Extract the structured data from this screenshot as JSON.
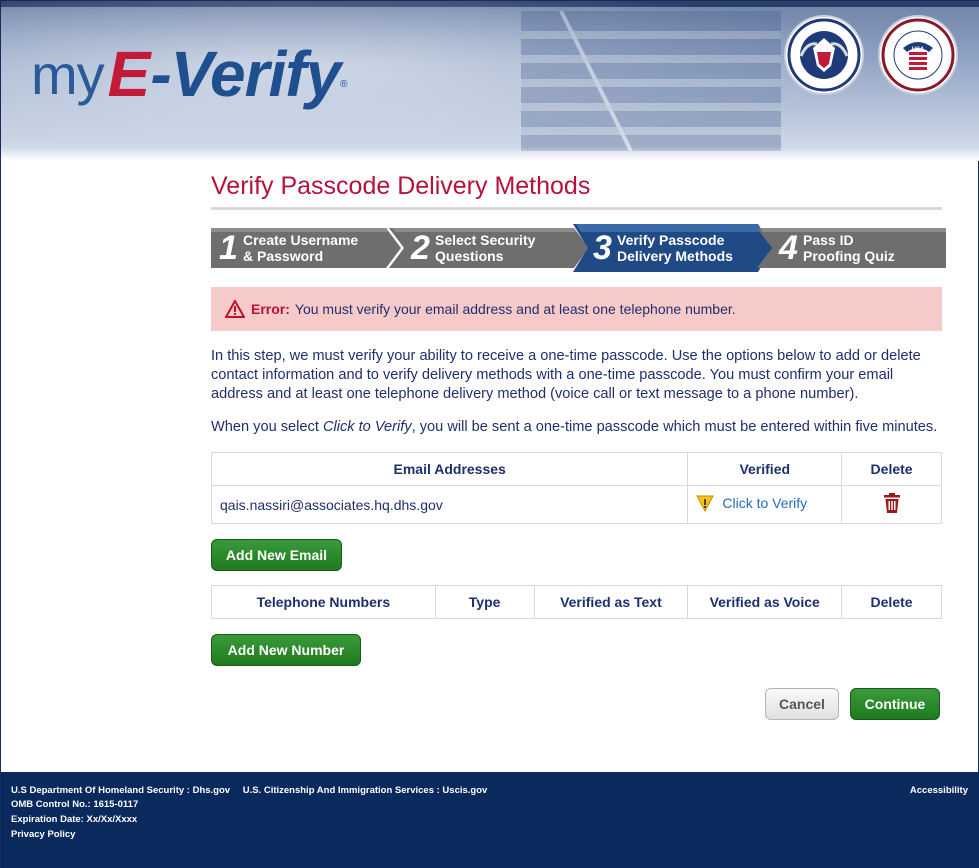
{
  "header": {
    "logo_my": "my",
    "logo_e": "E",
    "logo_verify": "-Verify",
    "logo_reg": "®",
    "seal_dhs_text": "U.S. DEPARTMENT OF HOMELAND SECURITY",
    "seal_ssa_text": "SOCIAL SECURITY ADMINISTRATION",
    "seal_ssa_usa": "USA"
  },
  "page": {
    "title": "Verify Passcode Delivery Methods"
  },
  "steps": [
    {
      "num": "1",
      "line1": "Create Username",
      "line2": "& Password",
      "active": false
    },
    {
      "num": "2",
      "line1": "Select Security",
      "line2": "Questions",
      "active": false
    },
    {
      "num": "3",
      "line1": "Verify Passcode",
      "line2": "Delivery Methods",
      "active": true
    },
    {
      "num": "4",
      "line1": "Pass ID",
      "line2": "Proofing Quiz",
      "active": false
    }
  ],
  "error": {
    "label": "Error:",
    "message": "You must verify your email address and at least one telephone number."
  },
  "intro": {
    "para1": "In this step, we must verify your ability to receive a one-time passcode. Use the options below to add or delete contact information and to verify delivery methods with a one-time passcode. You must confirm your email address and at least one telephone delivery method (voice call or text message to a phone number).",
    "para2_before": "When you select ",
    "para2_em": "Click to Verify",
    "para2_after": ", you will be sent a one-time passcode which must be entered within five minutes."
  },
  "email_table": {
    "headers": [
      "Email Addresses",
      "Verified",
      "Delete"
    ],
    "rows": [
      {
        "email": "qais.nassiri@associates.hq.dhs.gov",
        "verify_link": "Click to Verify"
      }
    ]
  },
  "add_email_label": "Add New Email",
  "phone_table": {
    "headers": [
      "Telephone Numbers",
      "Type",
      "Verified as Text",
      "Verified as Voice",
      "Delete"
    ]
  },
  "add_number_label": "Add New Number",
  "actions": {
    "cancel": "Cancel",
    "continue": "Continue"
  },
  "footer": {
    "dhs": "U.S Department Of Homeland Security : Dhs.gov",
    "uscis": "U.S. Citizenship And Immigration Services : Uscis.gov",
    "omb": "OMB Control No.: 1615-0117",
    "expiration": "Expiration Date: Xx/Xx/Xxxx",
    "privacy": "Privacy Policy",
    "accessibility": "Accessibility"
  },
  "colors": {
    "title_red": "#b5123c",
    "step_gray": "#6e6e6e",
    "step_active": "#1f4a85",
    "green_button": "#2a8a2a",
    "footer_blue": "#0a2a5e",
    "error_bg": "#f7caca"
  }
}
